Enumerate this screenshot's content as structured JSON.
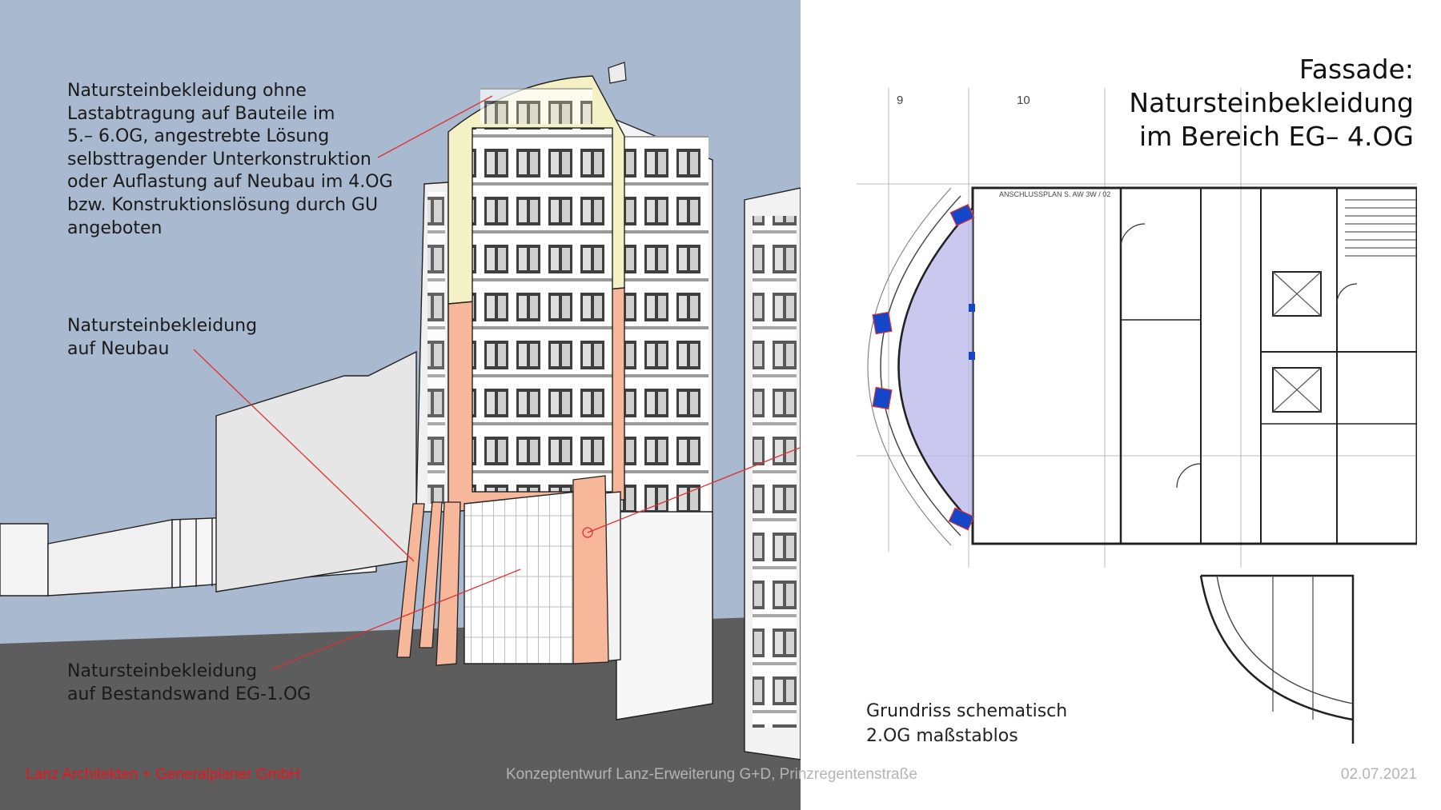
{
  "slide": {
    "title": "Fassade:\nNatursteinbekleidung\nim Bereich EG– 4.OG",
    "notes": [
      "Natursteinbekleidung ohne\nLastabtragung auf Bauteile im\n5.– 6.OG, angestrebte Lösung\nselbsttragender Unterkonstruktion\noder Auflastung auf Neubau im 4.OG\nbzw. Konstruktionslösung durch GU\nangeboten",
      "Natursteinbekleidung\nauf Neubau",
      "Natursteinbekleidung\nauf Bestandswand EG-1.OG"
    ],
    "plan_caption": "Grundriss schematisch\n2.OG maßstablos",
    "plan_labels": {
      "axis_9": "9",
      "axis_10": "10",
      "anschlussplan": "ANSCHLUSSPLAN  S. AW 3W / 02"
    }
  },
  "footer": {
    "company": "Lanz Architekten + Generalplaner GmbH",
    "project": "Konzeptentwurf Lanz-Erweiterung G+D, Prinzregentenstraße",
    "date": "02.07.2021"
  },
  "colors": {
    "sky": "#a9b9cf",
    "ground": "#5d5d5d",
    "stone_upper": "#f4f2c4",
    "stone_lower": "#f6b79a",
    "leader_line": "#e03030",
    "plan_highlight": "#b9b6ea",
    "plan_blue": "#1546c8",
    "company_text": "#e8141e",
    "muted_text": "#b4b4b4"
  }
}
